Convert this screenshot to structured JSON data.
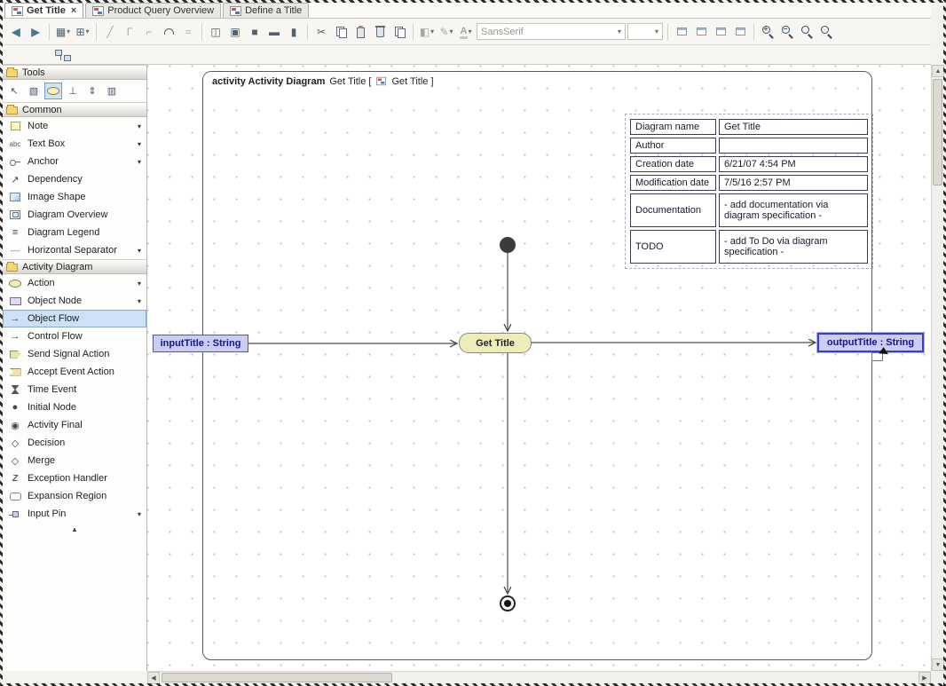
{
  "glyphs": {
    "caret_down": "▾",
    "close": "×",
    "back": "◀",
    "forward": "▶",
    "scroll_up": "▲",
    "scroll_down": "▼",
    "scroll_left": "◀",
    "scroll_right": "▶",
    "palette_up": "▲",
    "pointer": "↖",
    "marquee": "▧",
    "align": "⊥",
    "distribute": "⇕",
    "lanes": "▥",
    "grid": "▦",
    "grid_plus": "⊞",
    "diagonal": "╱",
    "corner1": "Γ",
    "corner2": "⌐",
    "wave": "≈",
    "box1": "◫",
    "box2": "▣",
    "box3": "■",
    "box4": "▬",
    "box5": "▮",
    "cut": "✂",
    "fill": "◧",
    "pencil": "✎",
    "font_a": "A",
    "plus": "+",
    "minus": "−",
    "abc": "abc",
    "dashes": "----",
    "dependency": "↗",
    "legend": "≡",
    "flow_arrow": "→",
    "initial_node": "●",
    "activity_final": "◉",
    "diamond": "◇",
    "zigzag": "Z"
  },
  "tabs": [
    {
      "label": "Get Title",
      "active": true
    },
    {
      "label": "Product Query Overview",
      "active": false
    },
    {
      "label": "Define a Title",
      "active": false
    }
  ],
  "toolbar": {
    "font_family": "SansSerif"
  },
  "sidebar": {
    "tools_title": "Tools",
    "common_title": "Common",
    "activity_title": "Activity Diagram",
    "common": [
      {
        "label": "Note"
      },
      {
        "label": "Text Box"
      },
      {
        "label": "Anchor"
      },
      {
        "label": "Dependency"
      },
      {
        "label": "Image Shape"
      },
      {
        "label": "Diagram Overview"
      },
      {
        "label": "Diagram Legend"
      },
      {
        "label": "Horizontal Separator"
      }
    ],
    "activity": [
      {
        "label": "Action"
      },
      {
        "label": "Object Node"
      },
      {
        "label": "Object Flow"
      },
      {
        "label": "Control Flow"
      },
      {
        "label": "Send Signal Action"
      },
      {
        "label": "Accept Event Action"
      },
      {
        "label": "Time Event"
      },
      {
        "label": "Initial Node"
      },
      {
        "label": "Activity Final"
      },
      {
        "label": "Decision"
      },
      {
        "label": "Merge"
      },
      {
        "label": "Exception Handler"
      },
      {
        "label": "Expansion Region"
      },
      {
        "label": "Input Pin"
      }
    ]
  },
  "canvas": {
    "frame": {
      "keyword": "activity Activity Diagram",
      "name": "Get Title [",
      "closing": "Get Title ]"
    },
    "info_table": {
      "rows": [
        {
          "label": "Diagram name",
          "value": "Get Title"
        },
        {
          "label": "Author",
          "value": ""
        },
        {
          "label": "Creation date",
          "value": "6/21/07 4:54 PM"
        },
        {
          "label": "Modification date",
          "value": "7/5/16 2:57 PM"
        },
        {
          "label": "Documentation",
          "value": "- add documentation via diagram specification -"
        },
        {
          "label": "TODO",
          "value": "- add To Do via diagram specification -"
        }
      ]
    },
    "nodes": {
      "action": "Get Title",
      "input": "inputTitle : String",
      "output": "outputTitle : String"
    }
  },
  "colors": {
    "selection_blue": "#3b3bd0",
    "object_node_fill": "#ccccf2",
    "action_fill": "#ededbb"
  }
}
